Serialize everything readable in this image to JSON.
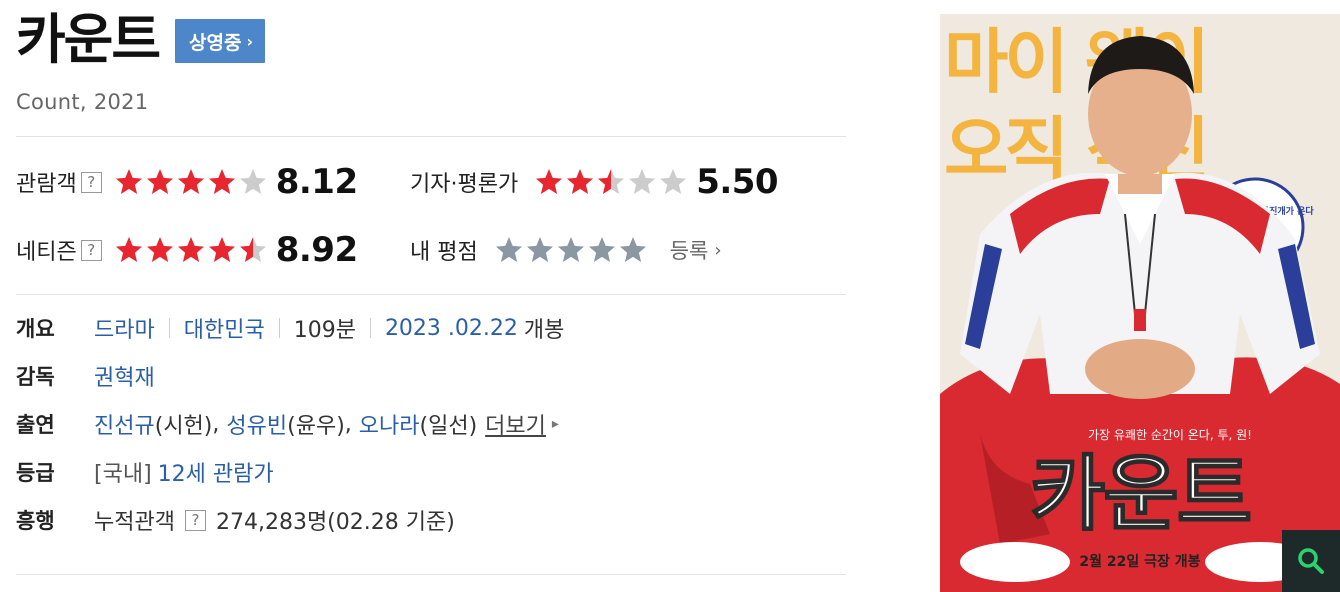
{
  "movie": {
    "title": "카운트",
    "status_label": "상영중",
    "subtitle": "Count, 2021"
  },
  "ratings": {
    "audience": {
      "label": "관람객",
      "score": "8.12",
      "stars": 4,
      "help": "?"
    },
    "critics": {
      "label": "기자·평론가",
      "score": "5.50",
      "stars": 2.5
    },
    "netizen": {
      "label": "네티즌",
      "score": "8.92",
      "stars": 4.5,
      "help": "?"
    },
    "mine": {
      "label": "내 평점",
      "stars": 0,
      "register_label": "등록"
    }
  },
  "info": {
    "overview": {
      "key": "개요",
      "genre": "드라마",
      "country": "대한민국",
      "runtime": "109분",
      "release_date": "2023 .02.22",
      "release_suffix": "개봉"
    },
    "director": {
      "key": "감독",
      "name": "권혁재"
    },
    "cast": {
      "key": "출연",
      "actors": [
        {
          "name": "진선규",
          "role": "(시헌)"
        },
        {
          "name": "성유빈",
          "role": "(윤우)"
        },
        {
          "name": "오나라",
          "role": "(일선)"
        }
      ],
      "more_label": "더보기"
    },
    "grade": {
      "key": "등급",
      "prefix": "[국내]",
      "value": "12세 관람가"
    },
    "boxoffice": {
      "key": "흥행",
      "label": "누적관객",
      "value": "274,283명(02.28 기준)"
    }
  },
  "poster": {
    "headline_1": "마이 웨이",
    "headline_2": "오직 직진",
    "badge": "2023년 짐받는 통진개가 온다",
    "tagline": "가장 유쾌한 순간이 온다, 투, 원!",
    "title": "카운트",
    "release": "2월 22일 극장 개봉"
  },
  "colors": {
    "star_active": "#e8262f",
    "star_inactive": "#cccccc",
    "star_mine": "#8b97a3",
    "link": "#2a5fa8",
    "status_bg": "#4e87c9"
  }
}
